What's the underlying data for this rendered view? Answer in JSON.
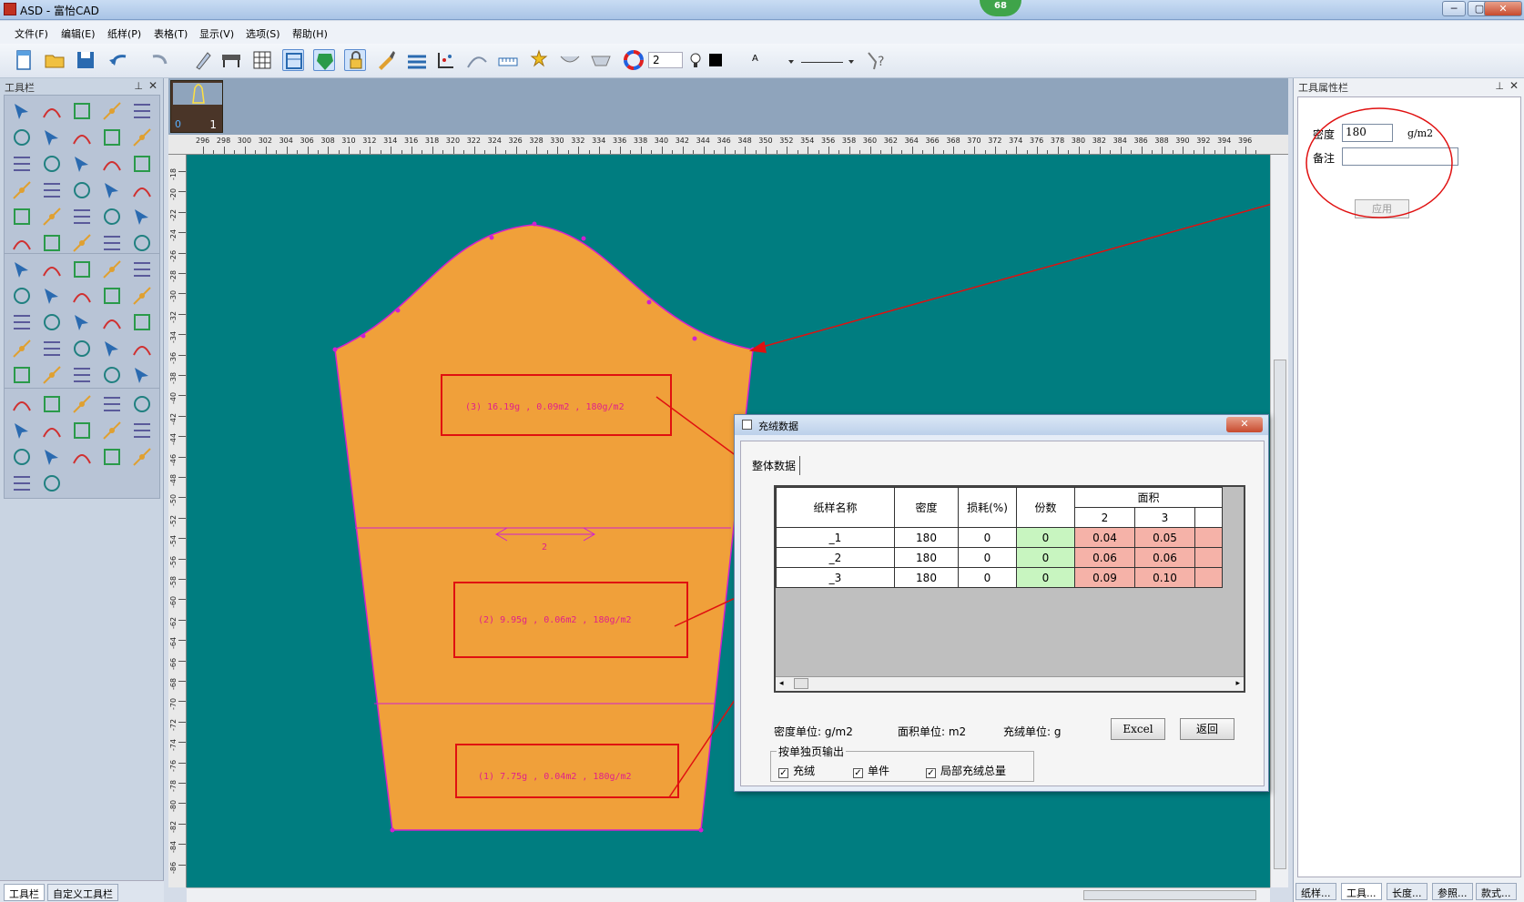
{
  "window": {
    "title": "ASD - 富怡CAD",
    "badge": "68",
    "min_label": "─",
    "max_label": "▢",
    "close_label": "✕"
  },
  "menu": [
    "文件(F)",
    "编辑(E)",
    "纸样(P)",
    "表格(T)",
    "显示(V)",
    "选项(S)",
    "帮助(H)"
  ],
  "toolbar": {
    "number_value": "2",
    "font_label": "A",
    "icons": [
      "new-file-icon",
      "open-folder-icon",
      "save-icon",
      "undo-icon",
      "redo-icon",
      "measure-pen-icon",
      "plotter-icon",
      "grid-table-icon",
      "seam-view-icon",
      "fill-piece-icon",
      "lock-piece-icon",
      "brush-icon",
      "layers-icon",
      "grade-points-icon",
      "curve-icon",
      "ruler-icon",
      "stars-icon",
      "trough-icon",
      "bowl-icon",
      "color-wheel-icon",
      "light-bulb-icon",
      "black-square-icon",
      "help-icon"
    ]
  },
  "left_panel": {
    "title": "工具栏",
    "pin": "📌",
    "close": "✕",
    "tabs": [
      "工具栏",
      "自定义工具栏"
    ]
  },
  "thumbnail": {
    "index_left": "0",
    "index_right": "1"
  },
  "ruler": {
    "h_labels": [
      "296",
      "298",
      "300",
      "302",
      "304",
      "306",
      "308",
      "310",
      "312",
      "314",
      "316",
      "318",
      "320",
      "322",
      "324",
      "326",
      "328",
      "330",
      "332",
      "334",
      "336",
      "338",
      "340",
      "342",
      "344",
      "346",
      "348",
      "350",
      "352",
      "354",
      "356",
      "358",
      "360",
      "362",
      "364",
      "366",
      "368",
      "370",
      "372",
      "374",
      "376",
      "378",
      "380",
      "382",
      "384",
      "386",
      "388",
      "390",
      "392",
      "394",
      "396"
    ],
    "v_labels": [
      "-18",
      "-20",
      "-22",
      "-24",
      "-26",
      "-28",
      "-30",
      "-32",
      "-34",
      "-36",
      "-38",
      "-40",
      "-42",
      "-44",
      "-46",
      "-48",
      "-50",
      "-52",
      "-54",
      "-56",
      "-58",
      "-60",
      "-62",
      "-64",
      "-66",
      "-68",
      "-70",
      "-72",
      "-74",
      "-76",
      "-78",
      "-80",
      "-82",
      "-84",
      "-86"
    ]
  },
  "canvas": {
    "annotations": [
      "(3) 16.19g , 0.09m2 , 180g/m2",
      "(2) 9.95g , 0.06m2 , 180g/m2",
      "(1) 7.75g , 0.04m2 , 180g/m2"
    ],
    "grain_label": "2",
    "colors": {
      "background": "#007d80",
      "piece": "#f0a03a",
      "outline": "#d020d0",
      "callout": "#e01010"
    }
  },
  "right_panel": {
    "title": "工具属性栏",
    "density_label": "密度",
    "density_value": "180",
    "density_unit": "g/m2",
    "note_label": "备注",
    "note_value": "",
    "apply_label": "应用",
    "tabs": [
      "纸样...",
      "工具...",
      "长度...",
      "参照...",
      "款式..."
    ]
  },
  "dialog": {
    "title": "充绒数据",
    "tab": "整体数据",
    "headers": {
      "name": "纸样名称",
      "density": "密度",
      "loss": "损耗(%)",
      "copies": "份数",
      "area": "面积",
      "area_cols": [
        "2",
        "3"
      ]
    },
    "rows": [
      {
        "name": "_1",
        "density": "180",
        "loss": "0",
        "copies": "0",
        "a2": "0.04",
        "a3": "0.05"
      },
      {
        "name": "_2",
        "density": "180",
        "loss": "0",
        "copies": "0",
        "a2": "0.06",
        "a3": "0.06"
      },
      {
        "name": "_3",
        "density": "180",
        "loss": "0",
        "copies": "0",
        "a2": "0.09",
        "a3": "0.10"
      }
    ],
    "units": {
      "density": "密度单位: g/m2",
      "area": "面积单位: m2",
      "fill": "充绒单位: g"
    },
    "excel_label": "Excel",
    "back_label": "返回",
    "export_group": "按单独页输出",
    "checks": [
      "充绒",
      "单件",
      "局部充绒总量"
    ]
  }
}
